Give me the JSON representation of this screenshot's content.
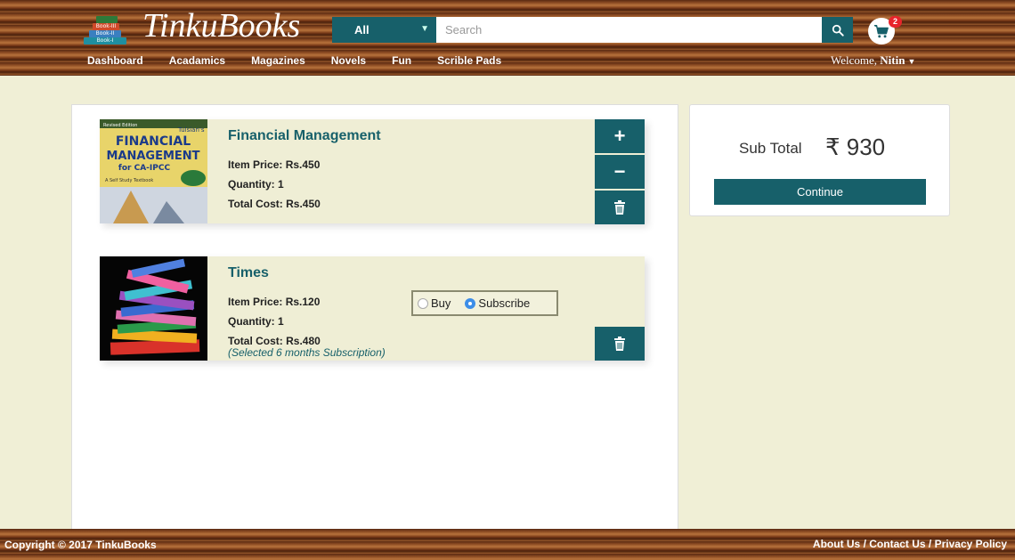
{
  "brand": {
    "name": "TinkuBooks",
    "logo_books": [
      "Book-I",
      "Book-II",
      "Book-III"
    ]
  },
  "search": {
    "category": "All",
    "placeholder": "Search"
  },
  "cart": {
    "count": "2"
  },
  "nav": [
    "Dashboard",
    "Acadamics",
    "Magazines",
    "Novels",
    "Fun",
    "Scrible Pads"
  ],
  "user": {
    "welcome": "Welcome,",
    "name": "Nitin"
  },
  "items": [
    {
      "title": "Financial Management",
      "price": "Item Price: Rs.450",
      "quantity": "Quantity: 1",
      "total": "Total Cost: Rs.450",
      "cover_text": {
        "publisher": "Tulsian's",
        "edition": "Revised Edition",
        "line1": "FINANCIAL",
        "line2": "MANAGEMENT",
        "line3": "for CA-IPCC",
        "tag": "A Self Study Textbook"
      }
    },
    {
      "title": "Times",
      "price": "Item Price: Rs.120",
      "quantity": "Quantity: 1",
      "total": "Total Cost: Rs.480",
      "note": "(Selected 6 months Subscription)",
      "options": {
        "buy": "Buy",
        "subscribe": "Subscribe",
        "selected": "subscribe"
      }
    }
  ],
  "summary": {
    "label": "Sub Total",
    "value": "₹ 930",
    "continue": "Continue"
  },
  "footer": {
    "copyright": "Copyright © 2017 TinkuBooks",
    "links": [
      "About Us",
      "Contact Us",
      "Privacy Policy"
    ]
  },
  "colors": {
    "accent": "#17606a",
    "badge": "#e8242b",
    "background": "#f0efd6"
  }
}
